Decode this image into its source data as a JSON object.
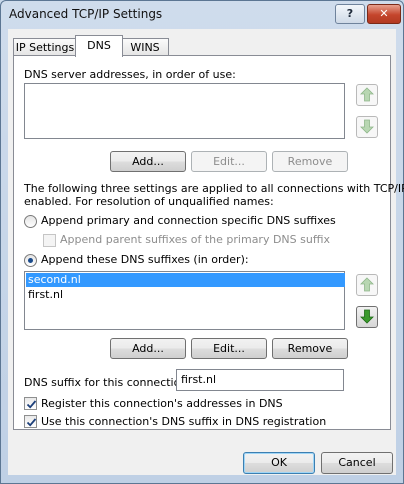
{
  "window": {
    "title": "Advanced TCP/IP Settings",
    "help_label": "?",
    "close_label": "✕"
  },
  "tabs": [
    {
      "label": "IP Settings",
      "active": false
    },
    {
      "label": "DNS",
      "active": true
    },
    {
      "label": "WINS",
      "active": false
    }
  ],
  "dns": {
    "servers_label": "DNS server addresses, in order of use:",
    "servers": [],
    "servers_buttons": {
      "add": "Add...",
      "edit": "Edit...",
      "remove": "Remove"
    },
    "info_text_line1": "The following three settings are applied to all connections with TCP/IP",
    "info_text_line2": "enabled. For resolution of unqualified names:",
    "radio_primary": {
      "label": "Append primary and connection specific DNS suffixes",
      "checked": false
    },
    "check_parent": {
      "label": "Append parent suffixes of the primary DNS suffix",
      "checked": false,
      "enabled": false
    },
    "radio_these": {
      "label": "Append these DNS suffixes (in order):",
      "checked": true
    },
    "suffixes": [
      {
        "text": "second.nl",
        "selected": true
      },
      {
        "text": "first.nl",
        "selected": false
      }
    ],
    "suffix_buttons": {
      "add": "Add...",
      "edit": "Edit...",
      "remove": "Remove"
    },
    "connection_suffix_label": "DNS suffix for this connection:",
    "connection_suffix_value": "first.nl",
    "check_register": {
      "label": "Register this connection's addresses in DNS",
      "checked": true
    },
    "check_use_suffix": {
      "label": "Use this connection's DNS suffix in DNS registration",
      "checked": true
    }
  },
  "footer": {
    "ok": "OK",
    "cancel": "Cancel"
  },
  "icons": {
    "up": "green-up-arrow-icon",
    "down": "green-down-arrow-icon"
  },
  "colors": {
    "selection": "#3399ff",
    "arrow_green": "#3a9a2c"
  }
}
